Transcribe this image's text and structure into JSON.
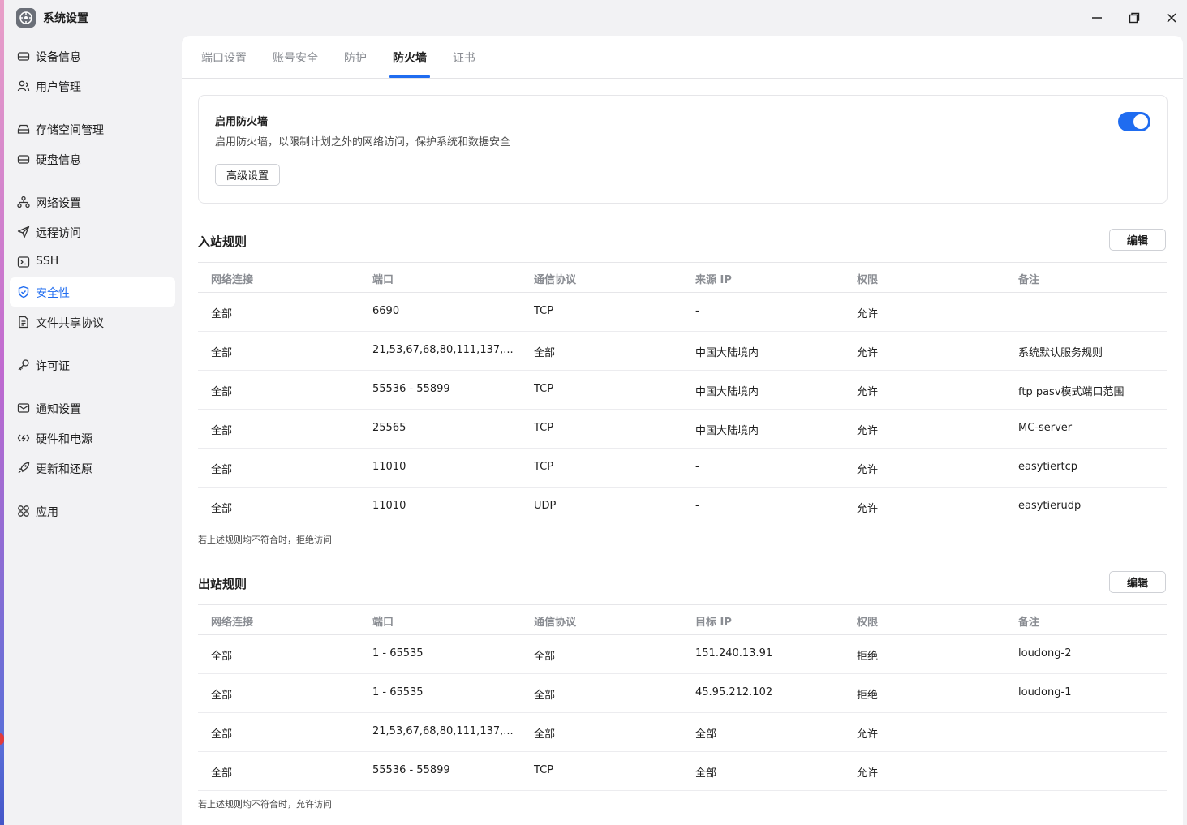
{
  "window": {
    "title": "系统设置",
    "controls": {
      "minimize": "minimize-icon",
      "maximize": "restore-icon",
      "close": "close-icon"
    }
  },
  "sidebar": {
    "items": [
      {
        "label": "设备信息",
        "icon": "drive-icon"
      },
      {
        "label": "用户管理",
        "icon": "users-icon"
      },
      {
        "label": "存储空间管理",
        "icon": "storage-icon"
      },
      {
        "label": "硬盘信息",
        "icon": "disk-icon"
      },
      {
        "label": "网络设置",
        "icon": "network-icon"
      },
      {
        "label": "远程访问",
        "icon": "send-icon"
      },
      {
        "label": "SSH",
        "icon": "terminal-icon"
      },
      {
        "label": "安全性",
        "icon": "shield-icon",
        "active": true
      },
      {
        "label": "文件共享协议",
        "icon": "file-icon"
      },
      {
        "label": "许可证",
        "icon": "key-icon"
      },
      {
        "label": "通知设置",
        "icon": "mail-icon"
      },
      {
        "label": "硬件和电源",
        "icon": "power-icon"
      },
      {
        "label": "更新和还原",
        "icon": "rocket-icon"
      },
      {
        "label": "应用",
        "icon": "apps-icon"
      }
    ]
  },
  "tabs": [
    {
      "label": "端口设置"
    },
    {
      "label": "账号安全"
    },
    {
      "label": "防护"
    },
    {
      "label": "防火墙",
      "active": true
    },
    {
      "label": "证书"
    }
  ],
  "firewall": {
    "title": "启用防火墙",
    "description": "启用防火墙，以限制计划之外的网络访问，保护系统和数据安全",
    "advanced_label": "高级设置",
    "enabled": true
  },
  "inbound": {
    "title": "入站规则",
    "edit_label": "编辑",
    "headers": [
      "网络连接",
      "端口",
      "通信协议",
      "来源 IP",
      "权限",
      "备注"
    ],
    "rows": [
      [
        "全部",
        "6690",
        "TCP",
        "-",
        "允许",
        ""
      ],
      [
        "全部",
        "21,53,67,68,80,111,137,...",
        "全部",
        "中国大陆境内",
        "允许",
        "系统默认服务规则"
      ],
      [
        "全部",
        "55536 - 55899",
        "TCP",
        "中国大陆境内",
        "允许",
        "ftp pasv模式端口范围"
      ],
      [
        "全部",
        "25565",
        "TCP",
        "中国大陆境内",
        "允许",
        "MC-server"
      ],
      [
        "全部",
        "11010",
        "TCP",
        "-",
        "允许",
        "easytiertcp"
      ],
      [
        "全部",
        "11010",
        "UDP",
        "-",
        "允许",
        "easytierudp"
      ]
    ],
    "footnote": "若上述规则均不符合时，拒绝访问"
  },
  "outbound": {
    "title": "出站规则",
    "edit_label": "编辑",
    "headers": [
      "网络连接",
      "端口",
      "通信协议",
      "目标 IP",
      "权限",
      "备注"
    ],
    "rows": [
      [
        "全部",
        "1 - 65535",
        "全部",
        "151.240.13.91",
        "拒绝",
        "loudong-2"
      ],
      [
        "全部",
        "1 - 65535",
        "全部",
        "45.95.212.102",
        "拒绝",
        "loudong-1"
      ],
      [
        "全部",
        "21,53,67,68,80,111,137,...",
        "全部",
        "全部",
        "允许",
        ""
      ],
      [
        "全部",
        "55536 - 55899",
        "TCP",
        "全部",
        "允许",
        ""
      ]
    ],
    "footnote": "若上述规则均不符合时，允许访问"
  },
  "colors": {
    "accent": "#1f6cf0",
    "sidebar_bg": "#f2f2f4",
    "content_bg": "#ffffff",
    "muted_text": "#8a8d93"
  }
}
